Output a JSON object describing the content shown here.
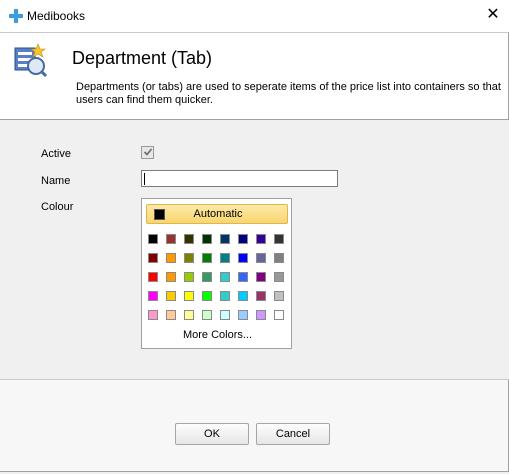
{
  "window": {
    "title": "Medibooks",
    "close_glyph": "✕"
  },
  "header": {
    "title": "Department (Tab)",
    "description": "Departments (or tabs) are used to seperate items of the price list into containers so that users can find them quicker.",
    "icon": "department-tab-icon"
  },
  "form": {
    "active_label": "Active",
    "active_checked": true,
    "name_label": "Name",
    "name_value": "",
    "colour_label": "Colour"
  },
  "colour_picker": {
    "automatic_label": "Automatic",
    "more_colors_label": "More Colors...",
    "rows": [
      [
        "#000000",
        "#993333",
        "#333300",
        "#003300",
        "#003366",
        "#000080",
        "#330099",
        "#333333"
      ],
      [
        "#800000",
        "#ff9900",
        "#808000",
        "#008000",
        "#008080",
        "#0000ff",
        "#666699",
        "#808080"
      ],
      [
        "#ff0000",
        "#ff9900",
        "#99cc00",
        "#339966",
        "#33cccc",
        "#3366ff",
        "#800080",
        "#999999"
      ],
      [
        "#ff00ff",
        "#ffcc00",
        "#ffff00",
        "#00ff00",
        "#33cccc",
        "#00ccff",
        "#993366",
        "#c0c0c0"
      ],
      [
        "#ff99cc",
        "#ffcc99",
        "#ffff99",
        "#ccffcc",
        "#ccffff",
        "#99ccff",
        "#cc99ff",
        "#ffffff"
      ]
    ]
  },
  "buttons": {
    "ok": "OK",
    "cancel": "Cancel"
  }
}
